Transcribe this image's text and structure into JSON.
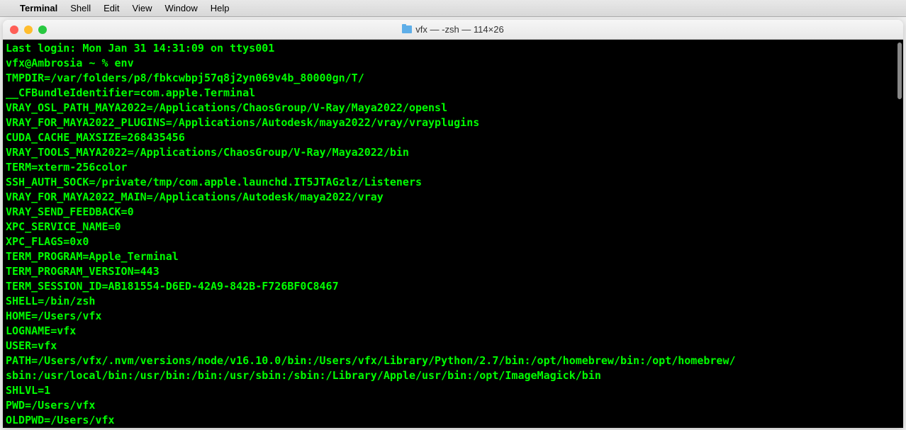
{
  "menubar": {
    "apple": "",
    "app": "Terminal",
    "items": [
      "Shell",
      "Edit",
      "View",
      "Window",
      "Help"
    ]
  },
  "window": {
    "title": "vfx — -zsh — 114×26"
  },
  "terminal": {
    "lines": [
      "Last login: Mon Jan 31 14:31:09 on ttys001",
      "vfx@Ambrosia ~ % env",
      "TMPDIR=/var/folders/p8/fbkcwbpj57q8j2yn069v4b_80000gn/T/",
      "__CFBundleIdentifier=com.apple.Terminal",
      "VRAY_OSL_PATH_MAYA2022=/Applications/ChaosGroup/V-Ray/Maya2022/opensl",
      "VRAY_FOR_MAYA2022_PLUGINS=/Applications/Autodesk/maya2022/vray/vrayplugins",
      "CUDA_CACHE_MAXSIZE=268435456",
      "VRAY_TOOLS_MAYA2022=/Applications/ChaosGroup/V-Ray/Maya2022/bin",
      "TERM=xterm-256color",
      "SSH_AUTH_SOCK=/private/tmp/com.apple.launchd.IT5JTAGzlz/Listeners",
      "VRAY_FOR_MAYA2022_MAIN=/Applications/Autodesk/maya2022/vray",
      "VRAY_SEND_FEEDBACK=0",
      "XPC_SERVICE_NAME=0",
      "XPC_FLAGS=0x0",
      "TERM_PROGRAM=Apple_Terminal",
      "TERM_PROGRAM_VERSION=443",
      "TERM_SESSION_ID=AB181554-D6ED-42A9-842B-F726BF0C8467",
      "SHELL=/bin/zsh",
      "HOME=/Users/vfx",
      "LOGNAME=vfx",
      "USER=vfx",
      "PATH=/Users/vfx/.nvm/versions/node/v16.10.0/bin:/Users/vfx/Library/Python/2.7/bin:/opt/homebrew/bin:/opt/homebrew/",
      "sbin:/usr/local/bin:/usr/bin:/bin:/usr/sbin:/sbin:/Library/Apple/usr/bin:/opt/ImageMagick/bin",
      "SHLVL=1",
      "PWD=/Users/vfx",
      "OLDPWD=/Users/vfx"
    ]
  }
}
